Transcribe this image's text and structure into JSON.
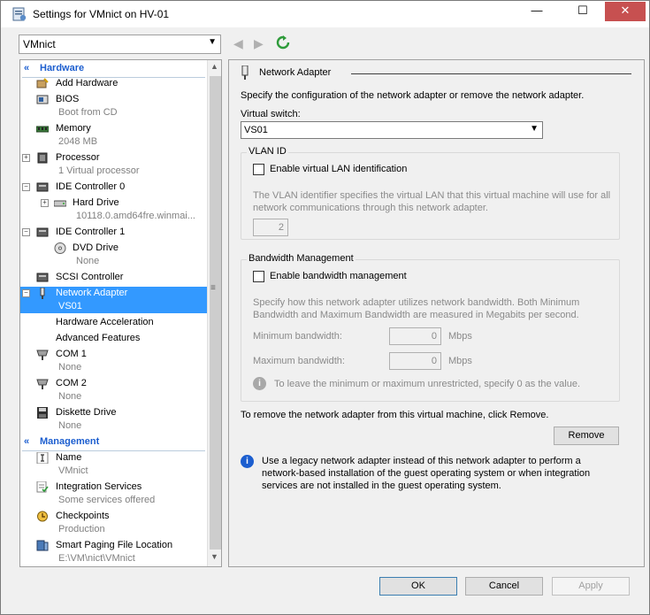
{
  "window": {
    "title": "Settings for VMnict on HV-01",
    "min_label": "—",
    "max_label": "☐",
    "close_label": "✕"
  },
  "toolbar": {
    "vm_name": "VMnict",
    "back_icon": "◀",
    "forward_icon": "▶"
  },
  "tree": {
    "hardware_section": "Hardware",
    "management_section": "Management",
    "add_hardware": "Add Hardware",
    "bios": "BIOS",
    "bios_sub": "Boot from CD",
    "memory": "Memory",
    "memory_sub": "2048 MB",
    "processor": "Processor",
    "processor_sub": "1 Virtual processor",
    "ide0": "IDE Controller 0",
    "hard_drive": "Hard Drive",
    "hard_drive_sub": "10118.0.amd64fre.winmai...",
    "ide1": "IDE Controller 1",
    "dvd_drive": "DVD Drive",
    "dvd_sub": "None",
    "scsi": "SCSI Controller",
    "network_adapter": "Network Adapter",
    "network_sub": "VS01",
    "hw_accel": "Hardware Acceleration",
    "adv_features": "Advanced Features",
    "com1": "COM 1",
    "com1_sub": "None",
    "com2": "COM 2",
    "com2_sub": "None",
    "diskette": "Diskette Drive",
    "diskette_sub": "None",
    "name": "Name",
    "name_sub": "VMnict",
    "integration": "Integration Services",
    "integration_sub": "Some services offered",
    "checkpoints": "Checkpoints",
    "checkpoints_sub": "Production",
    "paging": "Smart Paging File Location",
    "paging_sub": "E:\\VM\\nict\\VMnict"
  },
  "panel": {
    "title": "Network Adapter",
    "description": "Specify the configuration of the network adapter or remove the network adapter.",
    "switch_label": "Virtual switch:",
    "switch_value": "VS01",
    "vlan_group": "VLAN ID",
    "vlan_checkbox": "Enable virtual LAN identification",
    "vlan_desc_1": "The VLAN identifier specifies the virtual LAN that this virtual machine will use for all",
    "vlan_desc_2": "network communications through this network adapter.",
    "vlan_value": "2",
    "bw_group": "Bandwidth Management",
    "bw_checkbox": "Enable bandwidth management",
    "bw_desc_1": "Specify how this network adapter utilizes network bandwidth. Both Minimum",
    "bw_desc_2": "Bandwidth and Maximum Bandwidth are measured in Megabits per second.",
    "min_bw_label": "Minimum bandwidth:",
    "min_bw_value": "0",
    "max_bw_label": "Maximum bandwidth:",
    "max_bw_value": "0",
    "mbps": "Mbps",
    "bw_info": "To leave the minimum or maximum unrestricted, specify 0 as the value.",
    "remove_text": "To remove the network adapter from this virtual machine, click Remove.",
    "remove_button": "Remove",
    "legacy_1": "Use a legacy network adapter instead of this network adapter to perform a",
    "legacy_2": "network-based installation of the guest operating system or when integration",
    "legacy_3": "services are not installed in the guest operating system."
  },
  "footer": {
    "ok": "OK",
    "cancel": "Cancel",
    "apply": "Apply"
  }
}
